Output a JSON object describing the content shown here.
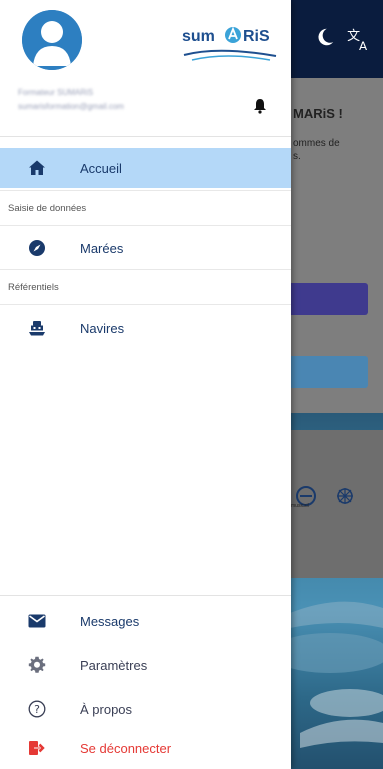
{
  "background": {
    "welcome_text": "MARiS !",
    "welcome_sub": "ommes de\ns.",
    "partner_text": "musicsil"
  },
  "drawer": {
    "brand": "SUMARiS",
    "user": {
      "name": "Formateur SUMARiS",
      "email": "sumarisformation@gmail.com"
    },
    "items": [
      {
        "label": "Accueil",
        "icon": "home-icon",
        "active": true
      }
    ],
    "sections": [
      {
        "label": "Saisie de données",
        "items": [
          {
            "label": "Marées",
            "icon": "compass-icon"
          }
        ]
      },
      {
        "label": "Référentiels",
        "items": [
          {
            "label": "Navires",
            "icon": "ship-icon"
          }
        ]
      }
    ],
    "footer": [
      {
        "label": "Messages",
        "icon": "mail-icon"
      },
      {
        "label": "Paramètres",
        "icon": "gear-icon"
      },
      {
        "label": "À propos",
        "icon": "help-circle-icon"
      },
      {
        "label": "Se déconnecter",
        "icon": "logout-icon",
        "color": "#e53935"
      }
    ]
  },
  "colors": {
    "primary": "#1a3a6b",
    "accent": "#2d7fc1",
    "active_bg": "#b4d8f8",
    "toolbar": "#0a1c3e",
    "danger": "#e53935"
  }
}
